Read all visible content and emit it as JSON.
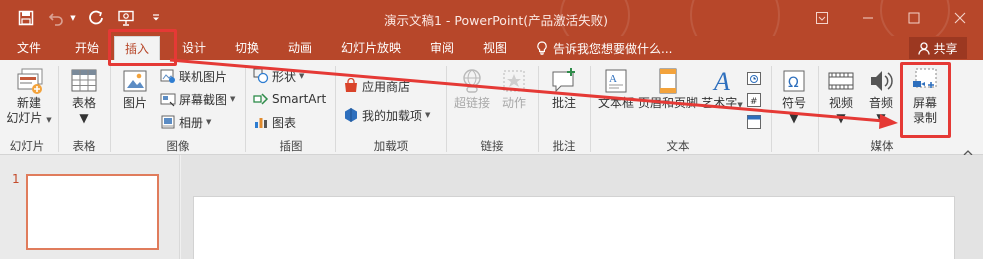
{
  "window": {
    "title": "演示文稿1 - PowerPoint(产品激活失败)",
    "colors": {
      "brand": "#b7472a",
      "ribbon": "#f3f3f3",
      "annotation": "#e53935"
    }
  },
  "qat": {
    "icons": [
      "save-icon",
      "undo-icon",
      "redo-icon",
      "present-from-start-icon",
      "customize-qat-icon"
    ]
  },
  "tabs": [
    {
      "label": "文件",
      "active": false
    },
    {
      "label": "开始",
      "active": false
    },
    {
      "label": "插入",
      "active": true
    },
    {
      "label": "设计",
      "active": false
    },
    {
      "label": "切换",
      "active": false
    },
    {
      "label": "动画",
      "active": false
    },
    {
      "label": "幻灯片放映",
      "active": false
    },
    {
      "label": "审阅",
      "active": false
    },
    {
      "label": "视图",
      "active": false
    }
  ],
  "tell_me": {
    "placeholder": "告诉我您想要做什么...",
    "icon": "lightbulb-icon"
  },
  "share": {
    "label": "共享",
    "icon": "person-icon"
  },
  "ribbon": {
    "new_slide": {
      "label1": "新建",
      "label2": "幻灯片"
    },
    "table": {
      "label": "表格"
    },
    "picture": {
      "label": "图片"
    },
    "online_pictures": {
      "label": "联机图片"
    },
    "screenshot": {
      "label": "屏幕截图"
    },
    "photo_album": {
      "label": "相册"
    },
    "shapes": {
      "label": "形状"
    },
    "smartart": {
      "label": "SmartArt"
    },
    "chart": {
      "label": "图表"
    },
    "store": {
      "label": "应用商店"
    },
    "my_addins": {
      "label": "我的加载项"
    },
    "hyperlink": {
      "label": "超链接"
    },
    "action": {
      "label": "动作"
    },
    "comment": {
      "label": "批注"
    },
    "textbox": {
      "label": "文本框"
    },
    "header_footer": {
      "label": "页眉和页脚"
    },
    "wordart": {
      "label": "艺术字"
    },
    "symbols": {
      "label": "符号"
    },
    "video": {
      "label": "视频"
    },
    "audio": {
      "label": "音频"
    },
    "screen_recording": {
      "label1": "屏幕",
      "label2": "录制"
    },
    "groups": {
      "slides": "幻灯片",
      "tables": "表格",
      "images": "图像",
      "illustrations": "插图",
      "addins": "加载项",
      "links": "链接",
      "comments": "批注",
      "text": "文本",
      "media": "媒体"
    }
  },
  "slides_pane": {
    "slide_number": "1"
  }
}
